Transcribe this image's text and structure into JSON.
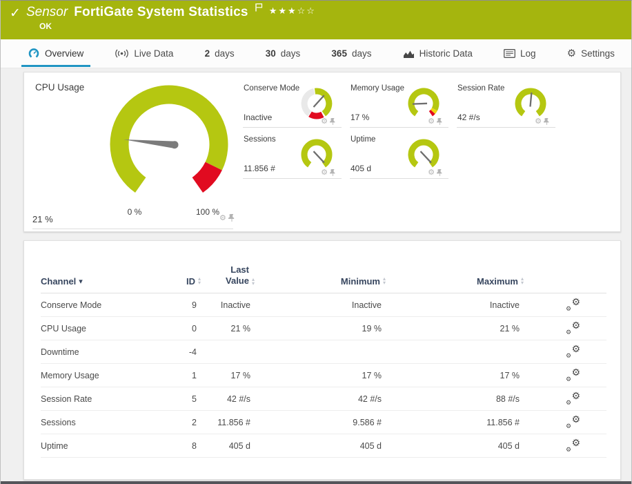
{
  "header": {
    "sensor_label": "Sensor",
    "title": "FortiGate System Statistics",
    "status": "OK",
    "stars": "★★★☆☆"
  },
  "tabs": {
    "overview": "Overview",
    "live_data": "Live Data",
    "d2_num": "2",
    "d2_unit": "days",
    "d30_num": "30",
    "d30_unit": "days",
    "d365_num": "365",
    "d365_unit": "days",
    "historic": "Historic Data",
    "log": "Log",
    "settings": "Settings"
  },
  "gauges": {
    "cpu": {
      "title": "CPU Usage",
      "value": "21 %",
      "scale_min": "0 %",
      "scale_max": "100 %"
    },
    "conserve": {
      "title": "Conserve Mode",
      "value": "Inactive"
    },
    "memory": {
      "title": "Memory Usage",
      "value": "17 %"
    },
    "session_rate": {
      "title": "Session Rate",
      "value": "42 #/s"
    },
    "sessions": {
      "title": "Sessions",
      "value": "11.856 #"
    },
    "uptime": {
      "title": "Uptime",
      "value": "405 d"
    }
  },
  "table": {
    "col_channel": "Channel",
    "col_id": "ID",
    "col_last": "Last Value",
    "col_min": "Minimum",
    "col_max": "Maximum",
    "rows": [
      {
        "channel": "Conserve Mode",
        "id": "9",
        "last": "Inactive",
        "min": "Inactive",
        "max": "Inactive"
      },
      {
        "channel": "CPU Usage",
        "id": "0",
        "last": "21 %",
        "min": "19 %",
        "max": "21 %"
      },
      {
        "channel": "Downtime",
        "id": "-4",
        "last": "",
        "min": "",
        "max": ""
      },
      {
        "channel": "Memory Usage",
        "id": "1",
        "last": "17 %",
        "min": "17 %",
        "max": "17 %"
      },
      {
        "channel": "Session Rate",
        "id": "5",
        "last": "42 #/s",
        "min": "42 #/s",
        "max": "88 #/s"
      },
      {
        "channel": "Sessions",
        "id": "2",
        "last": "11.856 #",
        "min": "9.586 #",
        "max": "11.856 #"
      },
      {
        "channel": "Uptime",
        "id": "8",
        "last": "405 d",
        "min": "405 d",
        "max": "405 d"
      }
    ]
  },
  "colors": {
    "header_bg": "#a5b50e",
    "gauge_green": "#b5c711",
    "gauge_red": "#e10b20",
    "accent_blue": "#2095c3"
  }
}
